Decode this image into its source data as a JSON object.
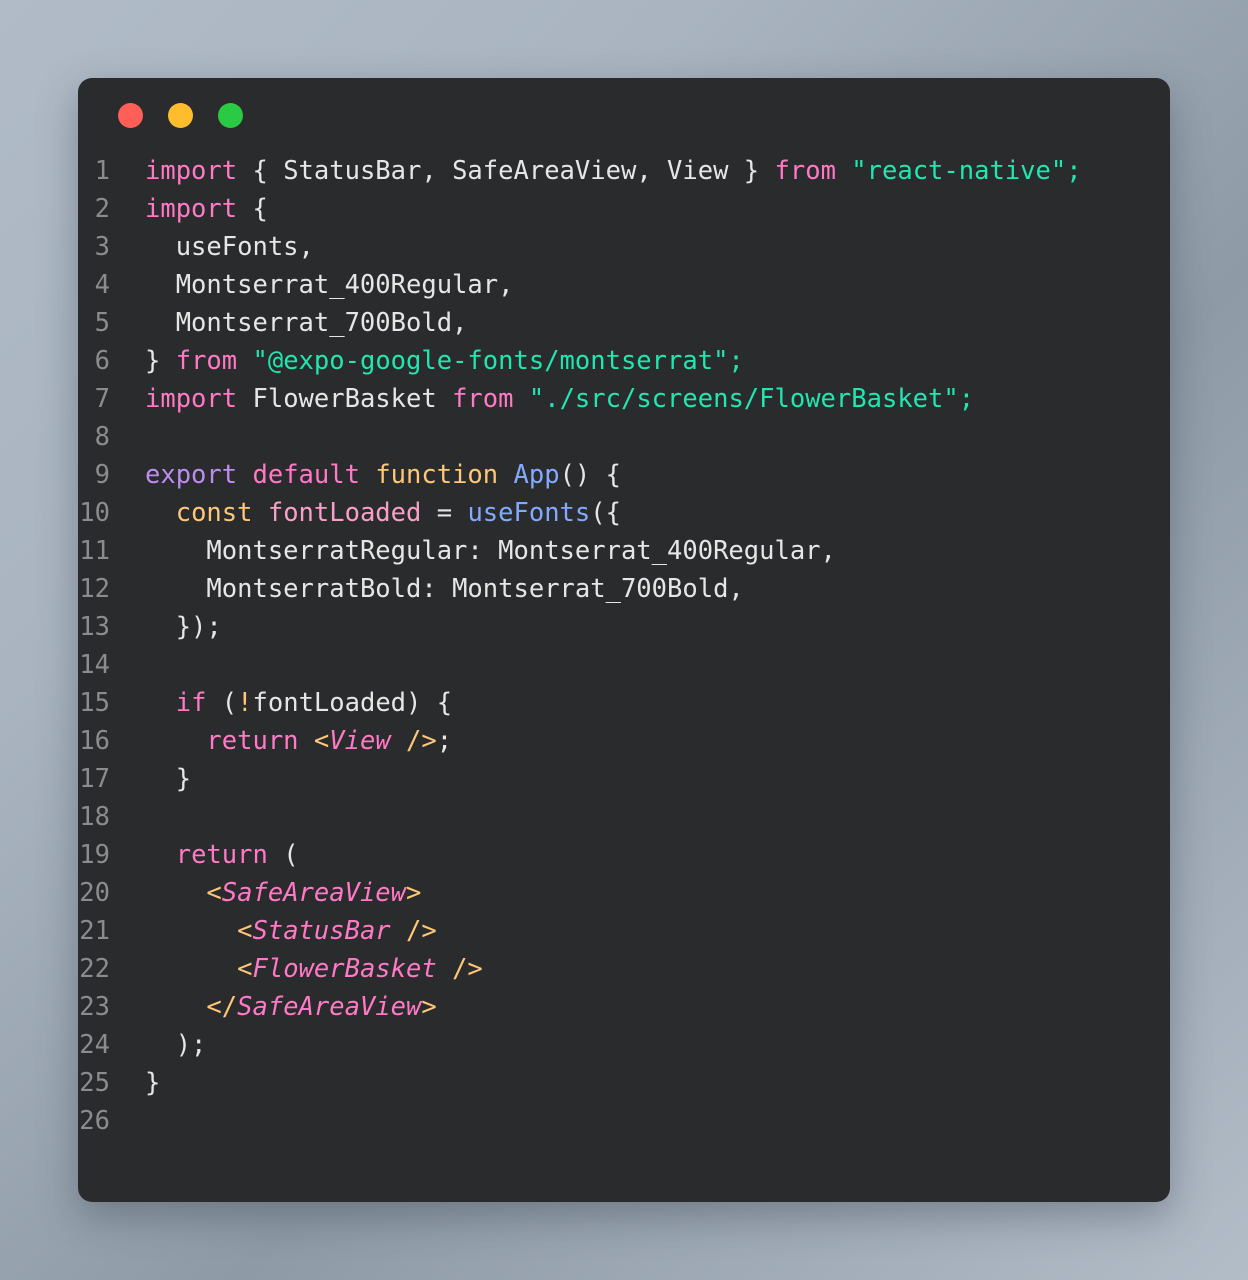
{
  "window": {
    "name": "code-snippet-window",
    "background_color": "#292b2c",
    "page_background": "#a9b4c0",
    "controls": [
      {
        "name": "close",
        "label": "",
        "color": "#ff5f56"
      },
      {
        "name": "minimize",
        "label": "",
        "color": "#ffbd2e"
      },
      {
        "name": "maximize",
        "label": "",
        "color": "#2bca44"
      }
    ]
  },
  "editor": {
    "language": "jsx",
    "total_lines": 26,
    "line_numbers": [
      "1",
      "2",
      "3",
      "4",
      "5",
      "6",
      "7",
      "8",
      "9",
      "10",
      "11",
      "12",
      "13",
      "14",
      "15",
      "16",
      "17",
      "18",
      "19",
      "20",
      "21",
      "22",
      "23",
      "24",
      "25",
      "26"
    ],
    "lines": [
      {
        "n": "1",
        "text": "import { StatusBar, SafeAreaView, View } from \"react-native\";"
      },
      {
        "n": "2",
        "text": "import {"
      },
      {
        "n": "3",
        "text": "  useFonts,"
      },
      {
        "n": "4",
        "text": "  Montserrat_400Regular,"
      },
      {
        "n": "5",
        "text": "  Montserrat_700Bold,"
      },
      {
        "n": "6",
        "text": "} from \"@expo-google-fonts/montserrat\";"
      },
      {
        "n": "7",
        "text": "import FlowerBasket from \"./src/screens/FlowerBasket\";"
      },
      {
        "n": "8",
        "text": ""
      },
      {
        "n": "9",
        "text": "export default function App() {"
      },
      {
        "n": "10",
        "text": "  const fontLoaded = useFonts({"
      },
      {
        "n": "11",
        "text": "    MontserratRegular: Montserrat_400Regular,"
      },
      {
        "n": "12",
        "text": "    MontserratBold: Montserrat_700Bold,"
      },
      {
        "n": "13",
        "text": "  });"
      },
      {
        "n": "14",
        "text": ""
      },
      {
        "n": "15",
        "text": "  if (!fontLoaded) {"
      },
      {
        "n": "16",
        "text": "    return <View />;"
      },
      {
        "n": "17",
        "text": "  }"
      },
      {
        "n": "18",
        "text": ""
      },
      {
        "n": "19",
        "text": "  return ("
      },
      {
        "n": "20",
        "text": "    <SafeAreaView>"
      },
      {
        "n": "21",
        "text": "      <StatusBar />"
      },
      {
        "n": "22",
        "text": "      <FlowerBasket />"
      },
      {
        "n": "23",
        "text": "    </SafeAreaView>"
      },
      {
        "n": "24",
        "text": "  );"
      },
      {
        "n": "25",
        "text": "}"
      },
      {
        "n": "26",
        "text": ""
      }
    ],
    "tokens": {
      "import": "import",
      "from": "from",
      "export": "export",
      "default": "default",
      "function": "function",
      "const": "const",
      "if": "if",
      "return": "return",
      "app_name": "App",
      "use_fonts": "useFonts",
      "font_loaded": "fontLoaded",
      "str_react_native": "\"react-native\";",
      "str_montserrat_pkg": "\"@expo-google-fonts/montserrat\";",
      "str_flower_basket_path": "\"./src/screens/FlowerBasket\";",
      "named_status_bar": "StatusBar",
      "named_safe_area_view": "SafeAreaView",
      "named_view": "View",
      "named_flower_basket": "FlowerBasket",
      "prop_montserrat_regular": "MontserratRegular",
      "prop_montserrat_bold": "MontserratBold",
      "val_montserrat_400": "Montserrat_400Regular",
      "val_montserrat_700": "Montserrat_700Bold"
    },
    "theme_colors": {
      "keyword": "#ff79c6",
      "export_keyword": "#bd8cf0",
      "function_keyword": "#ffc777",
      "identifier_blue": "#82aaff",
      "string": "#22e6b0",
      "plain": "#e6e6e6",
      "line_number": "#8a8d8f",
      "jsx_bracket": "#ffc777",
      "jsx_tag": "#ff79c6",
      "variable_pink": "#f8a0c8"
    }
  }
}
